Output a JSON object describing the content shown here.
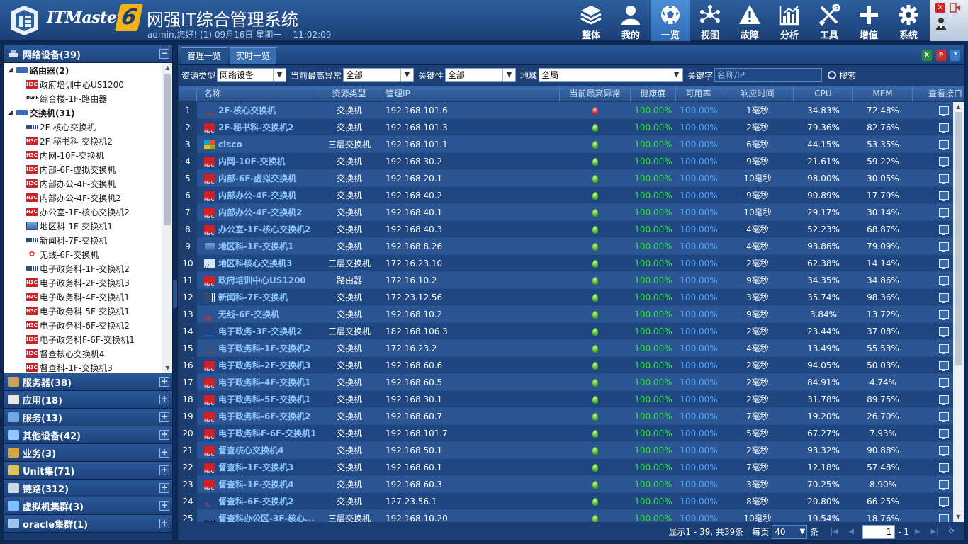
{
  "header": {
    "logo_text": "ITMaster",
    "logo_version": "6",
    "system_title": "网强IT综合管理系统",
    "user_line": "admin,您好! (1) 09月16日 星期一 -- 11:02:09",
    "nav": [
      {
        "label": "整体",
        "icon": "layers-icon"
      },
      {
        "label": "我的",
        "icon": "user-icon"
      },
      {
        "label": "一览",
        "icon": "football-icon",
        "active": true
      },
      {
        "label": "视图",
        "icon": "topology-icon"
      },
      {
        "label": "故障",
        "icon": "warning-icon"
      },
      {
        "label": "分析",
        "icon": "chart-icon"
      },
      {
        "label": "工具",
        "icon": "tools-icon"
      },
      {
        "label": "增值",
        "icon": "plus-icon"
      },
      {
        "label": "系统",
        "icon": "gear-icon"
      }
    ]
  },
  "sidebar": {
    "network_group": {
      "label": "网络设备(39)",
      "toggle": "−"
    },
    "tree": [
      {
        "label": "路由器(2)",
        "level": 0,
        "group": true,
        "icon": "grp",
        "toggle": "◢"
      },
      {
        "label": "政府培训中心US1200",
        "level": 1,
        "icon": "h3c"
      },
      {
        "label": "综合楼-1F-路由器",
        "level": 1,
        "icon": "dunk"
      },
      {
        "label": "交换机(31)",
        "level": 0,
        "group": true,
        "icon": "grp",
        "toggle": "◢"
      },
      {
        "label": "2F-核心交换机",
        "level": 1,
        "icon": "bar"
      },
      {
        "label": "2F-秘书科-交换机2",
        "level": 1,
        "icon": "h3c"
      },
      {
        "label": "内网-10F-交换机",
        "level": 1,
        "icon": "h3c"
      },
      {
        "label": "内部-6F-虚拟交换机",
        "level": 1,
        "icon": "h3c"
      },
      {
        "label": "内部办公-4F-交换机",
        "level": 1,
        "icon": "h3c"
      },
      {
        "label": "内部办公-4F-交换机2",
        "level": 1,
        "icon": "h3c"
      },
      {
        "label": "办公室-1F-核心交换机2",
        "level": 1,
        "icon": "h3c"
      },
      {
        "label": "地区科-1F-交换机1",
        "level": 1,
        "icon": "img"
      },
      {
        "label": "新闻科-7F-交换机",
        "level": 1,
        "icon": "bar"
      },
      {
        "label": "无线-6F-交换机",
        "level": 1,
        "icon": "hw"
      },
      {
        "label": "电子政务科-1F-交换机2",
        "level": 1,
        "icon": "bar"
      },
      {
        "label": "电子政务科-2F-交换机3",
        "level": 1,
        "icon": "h3c"
      },
      {
        "label": "电子政务科-4F-交换机1",
        "level": 1,
        "icon": "h3c"
      },
      {
        "label": "电子政务科-5F-交换机1",
        "level": 1,
        "icon": "h3c"
      },
      {
        "label": "电子政务科-6F-交换机2",
        "level": 1,
        "icon": "h3c"
      },
      {
        "label": "电子政务科F-6F-交换机1",
        "level": 1,
        "icon": "h3c"
      },
      {
        "label": "督查核心交换机4",
        "level": 1,
        "icon": "h3c"
      },
      {
        "label": "督查科-1F-交换机3",
        "level": 1,
        "icon": "h3c"
      }
    ],
    "groups": [
      {
        "label": "服务器(38)",
        "icon": "server-icon"
      },
      {
        "label": "应用(18)",
        "icon": "app-icon"
      },
      {
        "label": "服务(13)",
        "icon": "service-icon"
      },
      {
        "label": "其他设备(42)",
        "icon": "monitor-icon"
      },
      {
        "label": "业务(3)",
        "icon": "briefcase-icon"
      },
      {
        "label": "Unit集(71)",
        "icon": "unit-icon"
      },
      {
        "label": "链路(312)",
        "icon": "link-icon"
      },
      {
        "label": "虚拟机集群(3)",
        "icon": "cloud-icon"
      },
      {
        "label": "oracle集群(1)",
        "icon": "database-icon"
      }
    ],
    "group_toggle": "+"
  },
  "tabs": [
    {
      "label": "管理一览"
    },
    {
      "label": "实时一览",
      "active": true
    }
  ],
  "tab_tools": [
    "excel-icon",
    "pdf-icon",
    "help-icon"
  ],
  "filters": {
    "resource_type_label": "资源类型",
    "resource_type_value": "网络设备",
    "max_alarm_label": "当前最高异常",
    "max_alarm_value": "全部",
    "criticality_label": "关键性",
    "criticality_value": "全部",
    "region_label": "地域",
    "region_value": "全局",
    "keyword_label": "关键字",
    "keyword_placeholder": "名称/IP",
    "search_label": "搜索"
  },
  "table": {
    "columns": [
      "名称",
      "资源类型",
      "管理IP",
      "当前最高异常",
      "健康度",
      "可用率",
      "响应时间",
      "CPU",
      "MEM",
      "查看接口"
    ],
    "rows": [
      {
        "idx": "1",
        "icon": "cisco",
        "name": "2F-核心交换机",
        "type": "交换机",
        "ip": "192.168.101.6",
        "status": "red",
        "health": "100.00%",
        "avail": "100.00%",
        "resp": "1毫秒",
        "cpu": "34.83%",
        "mem": "72.48%"
      },
      {
        "idx": "2",
        "icon": "h3c",
        "name": "2F-秘书科-交换机2",
        "type": "交换机",
        "ip": "192.168.101.3",
        "status": "green",
        "health": "100.00%",
        "avail": "100.00%",
        "resp": "2毫秒",
        "cpu": "79.36%",
        "mem": "82.76%"
      },
      {
        "idx": "3",
        "icon": "win",
        "name": "cisco",
        "type": "三层交换机",
        "ip": "192.168.101.1",
        "status": "green",
        "health": "100.00%",
        "avail": "100.00%",
        "resp": "6毫秒",
        "cpu": "44.15%",
        "mem": "53.35%"
      },
      {
        "idx": "4",
        "icon": "h3c",
        "name": "内网-10F-交换机",
        "type": "交换机",
        "ip": "192.168.30.2",
        "status": "green",
        "health": "100.00%",
        "avail": "100.00%",
        "resp": "9毫秒",
        "cpu": "21.61%",
        "mem": "59.22%"
      },
      {
        "idx": "5",
        "icon": "h3c",
        "name": "内部-6F-虚拟交换机",
        "type": "交换机",
        "ip": "192.168.20.1",
        "status": "green",
        "health": "100.00%",
        "avail": "100.00%",
        "resp": "10毫秒",
        "cpu": "98.00%",
        "mem": "30.05%"
      },
      {
        "idx": "6",
        "icon": "h3c",
        "name": "内部办公-4F-交换机",
        "type": "交换机",
        "ip": "192.168.40.2",
        "status": "green",
        "health": "100.00%",
        "avail": "100.00%",
        "resp": "9毫秒",
        "cpu": "90.89%",
        "mem": "17.79%"
      },
      {
        "idx": "7",
        "icon": "h3c",
        "name": "内部办公-4F-交换机2",
        "type": "交换机",
        "ip": "192.168.40.1",
        "status": "green",
        "health": "100.00%",
        "avail": "100.00%",
        "resp": "10毫秒",
        "cpu": "29.17%",
        "mem": "30.14%"
      },
      {
        "idx": "8",
        "icon": "h3c",
        "name": "办公室-1F-核心交换机2",
        "type": "交换机",
        "ip": "192.168.40.3",
        "status": "green",
        "health": "100.00%",
        "avail": "100.00%",
        "resp": "4毫秒",
        "cpu": "52.23%",
        "mem": "68.87%"
      },
      {
        "idx": "9",
        "icon": "img",
        "name": "地区科-1F-交换机1",
        "type": "交换机",
        "ip": "192.168.8.26",
        "status": "green",
        "health": "100.00%",
        "avail": "100.00%",
        "resp": "4毫秒",
        "cpu": "93.86%",
        "mem": "79.09%"
      },
      {
        "idx": "10",
        "icon": "slash",
        "name": "地区科核心交换机3",
        "type": "三层交换机",
        "ip": "172.16.23.10",
        "status": "green",
        "health": "100.00%",
        "avail": "100.00%",
        "resp": "2毫秒",
        "cpu": "62.38%",
        "mem": "14.14%"
      },
      {
        "idx": "11",
        "icon": "h3c",
        "name": "政府培训中心US1200",
        "type": "路由器",
        "ip": "172.16.10.2",
        "status": "green",
        "health": "100.00%",
        "avail": "100.00%",
        "resp": "9毫秒",
        "cpu": "34.35%",
        "mem": "34.86%"
      },
      {
        "idx": "12",
        "icon": "bar",
        "name": "新闻科-7F-交换机",
        "type": "交换机",
        "ip": "172.23.12.56",
        "status": "green",
        "health": "100.00%",
        "avail": "100.00%",
        "resp": "3毫秒",
        "cpu": "35.74%",
        "mem": "98.36%"
      },
      {
        "idx": "13",
        "icon": "hw",
        "name": "无线-6F-交换机",
        "type": "交换机",
        "ip": "192.168.10.2",
        "status": "green",
        "health": "100.00%",
        "avail": "100.00%",
        "resp": "9毫秒",
        "cpu": "3.84%",
        "mem": "13.72%"
      },
      {
        "idx": "14",
        "icon": "blue",
        "name": "电子政务-3F-交换机2",
        "type": "三层交换机",
        "ip": "182.168.106.3",
        "status": "green",
        "health": "100.00%",
        "avail": "100.00%",
        "resp": "2毫秒",
        "cpu": "23.44%",
        "mem": "37.08%"
      },
      {
        "idx": "15",
        "icon": "cisco",
        "name": "电子政务科-1F-交换机2",
        "type": "交换机",
        "ip": "172.16.23.2",
        "status": "green",
        "health": "100.00%",
        "avail": "100.00%",
        "resp": "4毫秒",
        "cpu": "13.49%",
        "mem": "55.53%"
      },
      {
        "idx": "16",
        "icon": "h3c",
        "name": "电子政务科-2F-交换机3",
        "type": "交换机",
        "ip": "192.168.60.6",
        "status": "green",
        "health": "100.00%",
        "avail": "100.00%",
        "resp": "2毫秒",
        "cpu": "94.05%",
        "mem": "50.03%"
      },
      {
        "idx": "17",
        "icon": "h3c",
        "name": "电子政务科-4F-交换机1",
        "type": "交换机",
        "ip": "192.168.60.5",
        "status": "green",
        "health": "100.00%",
        "avail": "100.00%",
        "resp": "2毫秒",
        "cpu": "84.91%",
        "mem": "4.74%"
      },
      {
        "idx": "18",
        "icon": "h3c",
        "name": "电子政务科-5F-交换机1",
        "type": "交换机",
        "ip": "192.168.30.1",
        "status": "green",
        "health": "100.00%",
        "avail": "100.00%",
        "resp": "2毫秒",
        "cpu": "31.78%",
        "mem": "89.75%"
      },
      {
        "idx": "19",
        "icon": "h3c",
        "name": "电子政务科-6F-交换机2",
        "type": "交换机",
        "ip": "192.168.60.7",
        "status": "green",
        "health": "100.00%",
        "avail": "100.00%",
        "resp": "7毫秒",
        "cpu": "19.20%",
        "mem": "26.70%"
      },
      {
        "idx": "20",
        "icon": "h3c",
        "name": "电子政务科F-6F-交换机1",
        "type": "交换机",
        "ip": "192.168.101.7",
        "status": "green",
        "health": "100.00%",
        "avail": "100.00%",
        "resp": "5毫秒",
        "cpu": "67.27%",
        "mem": "7.93%"
      },
      {
        "idx": "21",
        "icon": "h3c",
        "name": "督查核心交换机4",
        "type": "交换机",
        "ip": "192.168.50.1",
        "status": "green",
        "health": "100.00%",
        "avail": "100.00%",
        "resp": "2毫秒",
        "cpu": "93.32%",
        "mem": "90.88%"
      },
      {
        "idx": "22",
        "icon": "h3c",
        "name": "督查科-1F-交换机3",
        "type": "交换机",
        "ip": "192.168.60.1",
        "status": "green",
        "health": "100.00%",
        "avail": "100.00%",
        "resp": "7毫秒",
        "cpu": "12.18%",
        "mem": "57.48%"
      },
      {
        "idx": "23",
        "icon": "h3c",
        "name": "督查科-1F-交换机4",
        "type": "交换机",
        "ip": "192.168.60.3",
        "status": "green",
        "health": "100.00%",
        "avail": "100.00%",
        "resp": "3毫秒",
        "cpu": "70.25%",
        "mem": "8.90%"
      },
      {
        "idx": "24",
        "icon": "pen",
        "name": "督查科-6F-交换机2",
        "type": "交换机",
        "ip": "127.23.56.1",
        "status": "green",
        "health": "100.00%",
        "avail": "100.00%",
        "resp": "8毫秒",
        "cpu": "20.80%",
        "mem": "66.25%"
      },
      {
        "idx": "25",
        "icon": "dunk",
        "name": "督查科办公区-3F-核心...",
        "type": "三层交换机",
        "ip": "192.168.10.20",
        "status": "green",
        "health": "100.00%",
        "avail": "100.00%",
        "resp": "10毫秒",
        "cpu": "19.54%",
        "mem": "18.76%"
      }
    ]
  },
  "pager": {
    "summary": "显示1 - 39, 共39条",
    "per_page_label": "每页",
    "per_page_value": "40",
    "per_page_unit": "条",
    "page_value": "1",
    "page_total": "- 1"
  }
}
